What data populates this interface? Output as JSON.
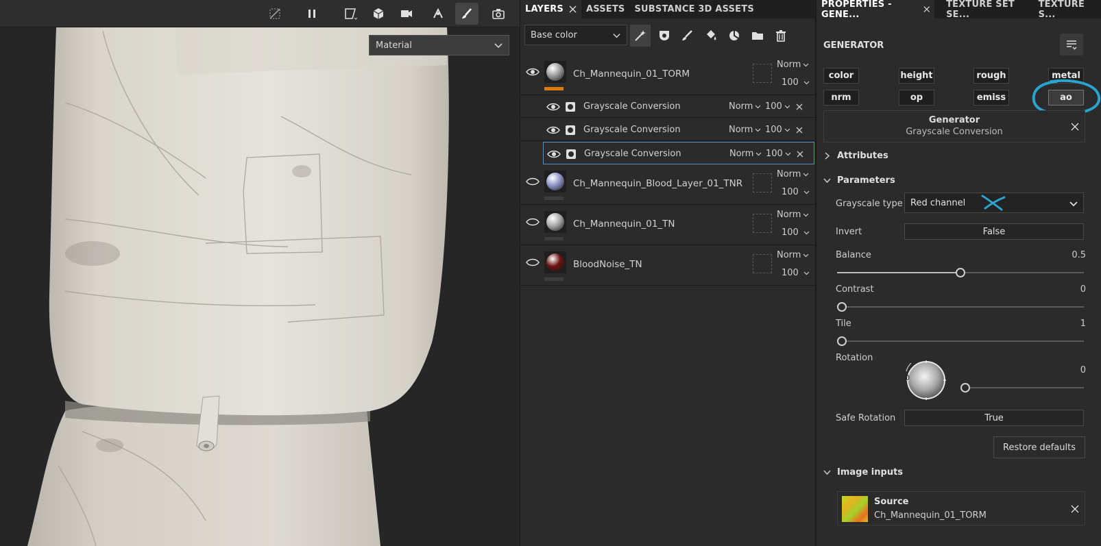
{
  "viewport": {
    "material_dropdown": "Material"
  },
  "layers_panel": {
    "tabs": [
      {
        "label": "LAYERS",
        "closable": true,
        "active": true
      },
      {
        "label": "ASSETS",
        "closable": false,
        "active": false
      },
      {
        "label": "SUBSTANCE 3D ASSETS",
        "closable": false,
        "active": false
      }
    ],
    "channel": "Base color",
    "layers": [
      {
        "name": "Ch_Mannequin_01_TORM",
        "blend": "Norm",
        "opacity": "100",
        "visible": true,
        "ball_color": "#9b9b9b",
        "bar_color": "#e07b10"
      },
      {
        "name": "Ch_Mannequin_Blood_Layer_01_TNR",
        "blend": "Norm",
        "opacity": "100",
        "visible": true,
        "ball_color": "#8c93c6",
        "bar_color": "#3e3e3e"
      },
      {
        "name": "Ch_Mannequin_01_TN",
        "blend": "Norm",
        "opacity": "100",
        "visible": true,
        "ball_color": "#a8a8a8",
        "bar_color": "#3e3e3e"
      },
      {
        "name": "BloodNoise_TN",
        "blend": "Norm",
        "opacity": "100",
        "visible": true,
        "ball_color": "#6a1212",
        "bar_color": "#3e3e3e"
      }
    ],
    "effects": [
      {
        "name": "Grayscale Conversion",
        "blend": "Norm",
        "opacity": "100"
      },
      {
        "name": "Grayscale Conversion",
        "blend": "Norm",
        "opacity": "100"
      },
      {
        "name": "Grayscale Conversion",
        "blend": "Norm",
        "opacity": "100",
        "selected": true
      }
    ]
  },
  "properties": {
    "tabs": [
      {
        "label": "PROPERTIES - GENE...",
        "closable": true,
        "active": true
      },
      {
        "label": "TEXTURE SET SE...",
        "closable": false,
        "active": false
      },
      {
        "label": "TEXTURE S...",
        "closable": false,
        "active": false
      }
    ],
    "title": "GENERATOR",
    "channels": [
      "color",
      "height",
      "rough",
      "metal",
      "nrm",
      "op",
      "emiss",
      "ao"
    ],
    "active_channel": "ao",
    "generator": {
      "title": "Generator",
      "name": "Grayscale Conversion"
    },
    "attributes_label": "Attributes",
    "parameters_label": "Parameters",
    "grayscale_type": {
      "label": "Grayscale type",
      "value": "Red channel"
    },
    "invert": {
      "label": "Invert",
      "value": "False"
    },
    "balance": {
      "label": "Balance",
      "value": "0.5",
      "fraction": 0.5
    },
    "contrast": {
      "label": "Contrast",
      "value": "0",
      "fraction": 0
    },
    "tile": {
      "label": "Tile",
      "value": "1",
      "fraction": 0
    },
    "rotation": {
      "label": "Rotation",
      "value": "0",
      "dial_value": "0",
      "fraction": 0
    },
    "safe_rotation": {
      "label": "Safe Rotation",
      "value": "True"
    },
    "restore_label": "Restore defaults",
    "image_inputs_label": "Image inputs",
    "source": {
      "title": "Source",
      "name": "Ch_Mannequin_01_TORM"
    },
    "annotation_color": "#2aa3cf"
  }
}
